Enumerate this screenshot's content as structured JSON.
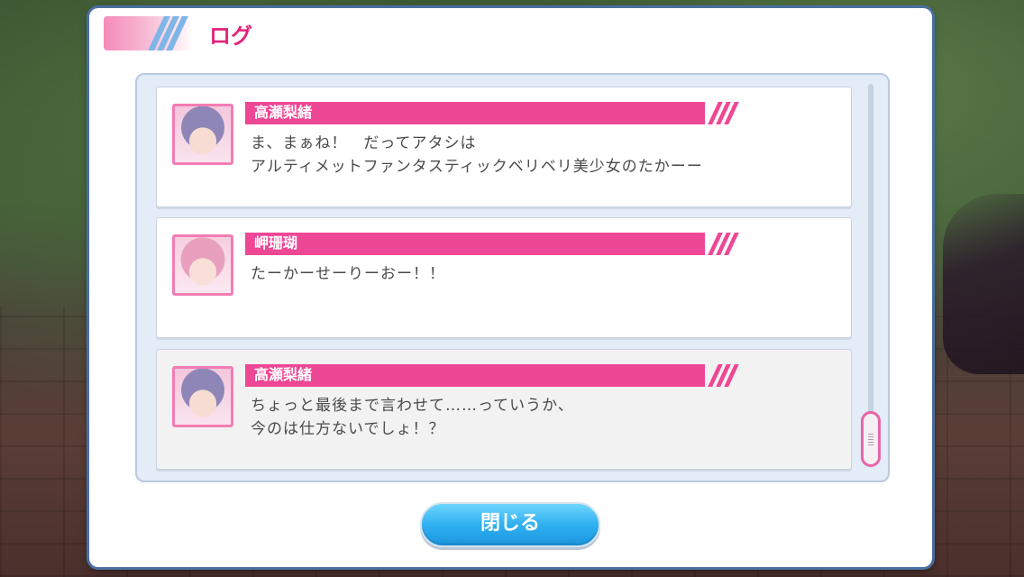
{
  "window": {
    "title": "ログ"
  },
  "log": {
    "entries": [
      {
        "speaker": "高瀬梨緒",
        "lines": [
          "ま、まぁね！　だってアタシは",
          "アルティメットファンタスティックベリベリ美少女のたかーー"
        ]
      },
      {
        "speaker": "岬珊瑚",
        "lines": [
          "たーかーせーりーおー！！"
        ]
      },
      {
        "speaker": "高瀬梨緒",
        "lines": [
          "ちょっと最後まで言わせて……っていうか、",
          "今のは仕方ないでしょ！？"
        ]
      }
    ]
  },
  "close_button": {
    "label": "閉じる"
  },
  "colors": {
    "accent_pink": "#ee4795",
    "title_pink": "#e0237a",
    "button_blue": "#2fb0f0",
    "frame_blue": "#4a6fa0"
  },
  "icons": [
    "speaker-avatar-icon",
    "scroll-thumb-grip-icon"
  ]
}
